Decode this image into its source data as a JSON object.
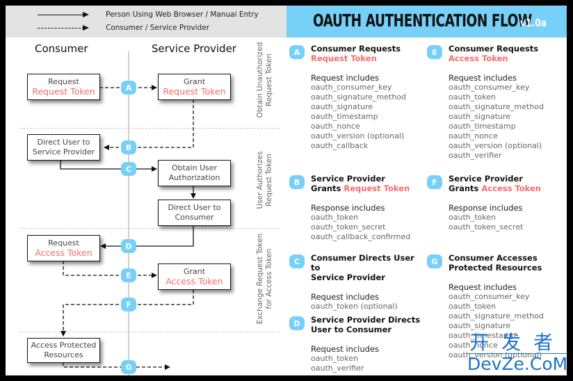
{
  "legend": {
    "solid_label": "Person Using Web Browser / Manual Entry",
    "dashed_label": "Consumer / Service Provider"
  },
  "header": {
    "title": "OAUTH AUTHENTICATION FLOW",
    "version": "v1.0a"
  },
  "colors": {
    "accent_blue": "#76d0f8",
    "token_red": "#f06d6a",
    "legend_bg": "#e3e3e3"
  },
  "diagram": {
    "lanes": {
      "consumer": "Consumer",
      "provider": "Service Provider"
    },
    "phases": [
      {
        "line1": "Obtain Unauthorized",
        "line2": "Request Token"
      },
      {
        "line1": "User Authorizes",
        "line2": "Request Token"
      },
      {
        "line1": "Exchange Request Token",
        "line2": "for Access Token"
      }
    ],
    "boxes": {
      "request_request_token": {
        "line1": "Request",
        "line2": "Request Token"
      },
      "grant_request_token": {
        "line1": "Grant",
        "line2": "Request Token"
      },
      "direct_user_to_sp": {
        "line1": "Direct User to",
        "line2": "Service Provider"
      },
      "obtain_user_auth": {
        "line1": "Obtain User",
        "line2": "Authorization"
      },
      "direct_user_to_consumer": {
        "line1": "Direct User to",
        "line2": "Consumer"
      },
      "request_access_token": {
        "line1": "Request",
        "line2": "Access Token"
      },
      "grant_access_token": {
        "line1": "Grant",
        "line2": "Access Token"
      },
      "access_protected": {
        "line1": "Access Protected",
        "line2": "Resources"
      }
    },
    "steps": [
      "A",
      "B",
      "C",
      "D",
      "E",
      "F",
      "G"
    ]
  },
  "details": {
    "A": {
      "badge": "A",
      "title": "Consumer Requests",
      "title_red": "Request Token",
      "sub": "Request includes",
      "params": [
        "oauth_consumer_key",
        "oauth_signature_method",
        "oauth_signature",
        "oauth_timestamp",
        "oauth_nonce",
        "oauth_version (optional)",
        "oauth_callback"
      ]
    },
    "B": {
      "badge": "B",
      "title": "Service Provider",
      "title2": "Grants ",
      "title_red": "Request Token",
      "sub": "Response includes",
      "params": [
        "oauth_token",
        "oauth_token_secret",
        "oauth_callback_confirmed"
      ]
    },
    "C": {
      "badge": "C",
      "title": "Consumer Directs User to",
      "title2": "Service Provider",
      "sub": "Request includes",
      "params": [
        "oauth_token (optional)"
      ]
    },
    "D": {
      "badge": "D",
      "title": "Service Provider Directs",
      "title2": "User to Consumer",
      "sub": "Request includes",
      "params": [
        "oauth_token",
        "oauth_verifier"
      ]
    },
    "E": {
      "badge": "E",
      "title": "Consumer Requests",
      "title_red": "Access Token",
      "sub": "Request includes",
      "params": [
        "oauth_consumer_key",
        "oauth_token",
        "oauth_signature_method",
        "oauth_signature",
        "oauth_timestamp",
        "oauth_nonce",
        "oauth_version (optional)",
        "oauth_verifier"
      ]
    },
    "F": {
      "badge": "F",
      "title": "Service Provider",
      "title2": "Grants ",
      "title_red": "Access Token",
      "sub": "Response includes",
      "params": [
        "oauth_token",
        "oauth_token_secret"
      ]
    },
    "G": {
      "badge": "G",
      "title": "Consumer Accesses",
      "title2": "Protected Resources",
      "sub": "Request includes",
      "params": [
        "oauth_consumer_key",
        "oauth_token",
        "oauth_signature_method",
        "oauth_signature",
        "oauth_timestamp",
        "oauth_nonce",
        "oauth_version (optional)"
      ]
    }
  },
  "watermark": {
    "cn": "开发者",
    "en": "DevZe.CoM"
  }
}
